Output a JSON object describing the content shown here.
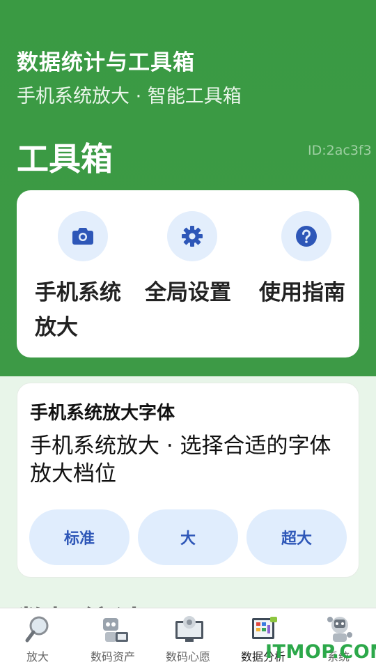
{
  "header": {
    "app_title": "数据统计与工具箱",
    "app_subtitle": "手机系统放大 · 智能工具箱",
    "section_title": "工具箱",
    "id_text": "ID:2ac3f3"
  },
  "tools": [
    {
      "label": "手机系统放大",
      "icon": "camera-icon"
    },
    {
      "label": "全局设置",
      "icon": "gear-icon"
    },
    {
      "label": "使用指南",
      "icon": "help-icon"
    }
  ],
  "font_card": {
    "title": "手机系统放大字体",
    "description": "手机系统放大 · 选择合适的字体放大档位",
    "options": [
      "标准",
      "大",
      "超大"
    ]
  },
  "behind_title": "数据统计",
  "tabbar": {
    "tabs": [
      {
        "label": "放大",
        "icon": "magnifier-icon"
      },
      {
        "label": "数码资产",
        "icon": "robot-asset-icon"
      },
      {
        "label": "数码心愿",
        "icon": "monitor-flower-icon"
      },
      {
        "label": "数据分析",
        "icon": "analysis-icon"
      },
      {
        "label": "系统",
        "icon": "robot-head-icon"
      }
    ],
    "active_index": 3
  },
  "watermark": "ITMOP.COM",
  "colors": {
    "header_green": "#3d9a46",
    "accent_blue": "#2e57b8",
    "button_bg": "#e0edfd",
    "page_bg": "#e8f5e9"
  }
}
